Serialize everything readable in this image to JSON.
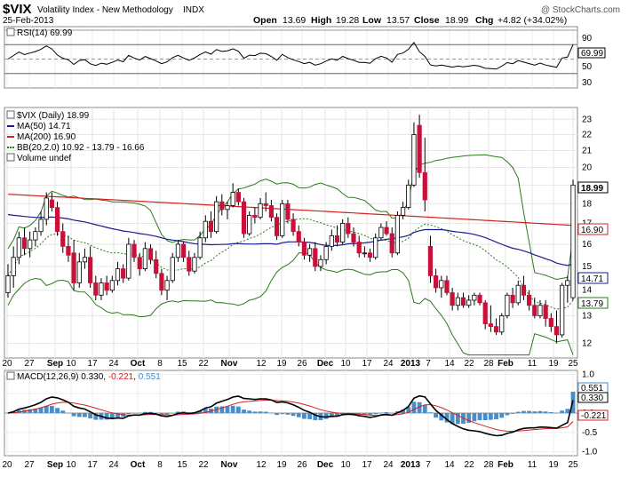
{
  "header": {
    "symbol": "$VIX",
    "name": "Volatility Index - New Methodology",
    "exchange": "INDX",
    "date": "25-Feb-2013",
    "watermark": "@ StockCharts.com",
    "open_label": "Open",
    "open": "13.69",
    "high_label": "High",
    "high": "19.28",
    "low_label": "Low",
    "low": "13.57",
    "close_label": "Close",
    "close": "18.99",
    "chg_label": "Chg",
    "chg": "+4.82 (+34.02%)"
  },
  "rsi": {
    "legend": "RSI(14) 69.99",
    "value_badge": "69.99",
    "ticks": [
      "90",
      "50",
      "30"
    ]
  },
  "price": {
    "legend": {
      "main": "$VIX (Daily) 18.99",
      "ma50": "MA(50) 14.71",
      "ma200": "MA(200) 16.90",
      "bb": "BB(20,2.0) 10.92 - 13.79 - 16.66",
      "volume": "Volume undef"
    },
    "badges": {
      "close": "18.99",
      "ma200": "16.90",
      "ma50": "14.71",
      "bb_mid": "13.79"
    },
    "yticks": [
      "23",
      "22",
      "21",
      "20",
      "19",
      "18",
      "17",
      "16",
      "15",
      "14",
      "13",
      "12"
    ],
    "colors": {
      "up": "#000000",
      "down": "#c8103a",
      "ma50": "#1a1a8c",
      "ma200": "#d42020",
      "bb": "#2a7a1a",
      "bbmid": "#2a7a1a"
    }
  },
  "xaxis": {
    "labels": [
      "20",
      "27",
      "Sep",
      "10",
      "17",
      "24",
      "Oct",
      "8",
      "15",
      "22",
      "Nov",
      "12",
      "19",
      "26",
      "Dec",
      "10",
      "17",
      "24",
      "2013",
      "7",
      "14",
      "22",
      "28",
      "Feb",
      "11",
      "19",
      "25"
    ]
  },
  "macd": {
    "legend_prefix": "MACD(12,26,9)",
    "legend_v1": "0.330",
    "legend_v2": "-0.221",
    "legend_v3": "0.551",
    "badges": {
      "hist": "0.551",
      "macd": "0.330",
      "signal": "-0.221"
    },
    "ticks": [
      "1.0",
      "0.5",
      "0.0",
      "-0.5",
      "-1.0"
    ],
    "colors": {
      "macd": "#000000",
      "signal": "#d42020",
      "hist": "#4a8ec8"
    }
  },
  "chart_data": {
    "type": "candlestick",
    "title": "$VIX Volatility Index - New Methodology INDX",
    "date": "25-Feb-2013",
    "y_range": [
      11.5,
      23.8
    ],
    "candles": [
      {
        "o": 13.9,
        "h": 15.1,
        "l": 13.7,
        "c": 14.6
      },
      {
        "o": 14.6,
        "h": 15.9,
        "l": 14.1,
        "c": 15.4
      },
      {
        "o": 15.4,
        "h": 16.6,
        "l": 15.1,
        "c": 16.3
      },
      {
        "o": 16.3,
        "h": 16.8,
        "l": 15.5,
        "c": 15.8
      },
      {
        "o": 15.8,
        "h": 16.6,
        "l": 15.4,
        "c": 16.2
      },
      {
        "o": 16.2,
        "h": 16.8,
        "l": 15.9,
        "c": 16.6
      },
      {
        "o": 16.6,
        "h": 17.6,
        "l": 16.4,
        "c": 17.2
      },
      {
        "o": 17.2,
        "h": 18.6,
        "l": 16.9,
        "c": 18.3
      },
      {
        "o": 18.2,
        "h": 18.6,
        "l": 17.6,
        "c": 17.8
      },
      {
        "o": 17.8,
        "h": 18.1,
        "l": 16.4,
        "c": 16.6
      },
      {
        "o": 16.6,
        "h": 17.0,
        "l": 15.6,
        "c": 15.9
      },
      {
        "o": 15.9,
        "h": 16.4,
        "l": 15.2,
        "c": 15.5
      },
      {
        "o": 15.6,
        "h": 16.2,
        "l": 14.0,
        "c": 14.3
      },
      {
        "o": 14.3,
        "h": 15.6,
        "l": 14.1,
        "c": 15.2
      },
      {
        "o": 15.2,
        "h": 15.8,
        "l": 14.9,
        "c": 15.4
      },
      {
        "o": 15.4,
        "h": 15.9,
        "l": 14.1,
        "c": 14.3
      },
      {
        "o": 14.3,
        "h": 14.6,
        "l": 13.6,
        "c": 13.8
      },
      {
        "o": 13.8,
        "h": 14.5,
        "l": 13.6,
        "c": 14.3
      },
      {
        "o": 14.3,
        "h": 14.6,
        "l": 13.8,
        "c": 14.0
      },
      {
        "o": 14.0,
        "h": 14.6,
        "l": 13.9,
        "c": 14.4
      },
      {
        "o": 14.4,
        "h": 15.2,
        "l": 14.2,
        "c": 14.9
      },
      {
        "o": 14.9,
        "h": 15.1,
        "l": 14.3,
        "c": 14.5
      },
      {
        "o": 14.5,
        "h": 16.3,
        "l": 14.4,
        "c": 16.0
      },
      {
        "o": 16.0,
        "h": 16.2,
        "l": 15.2,
        "c": 15.4
      },
      {
        "o": 15.4,
        "h": 15.6,
        "l": 14.6,
        "c": 14.9
      },
      {
        "o": 14.9,
        "h": 16.1,
        "l": 14.8,
        "c": 15.8
      },
      {
        "o": 15.8,
        "h": 16.0,
        "l": 15.1,
        "c": 15.3
      },
      {
        "o": 15.3,
        "h": 15.7,
        "l": 14.5,
        "c": 14.7
      },
      {
        "o": 14.7,
        "h": 14.9,
        "l": 13.8,
        "c": 14.0
      },
      {
        "o": 14.0,
        "h": 14.6,
        "l": 13.6,
        "c": 14.4
      },
      {
        "o": 14.4,
        "h": 15.6,
        "l": 14.3,
        "c": 15.4
      },
      {
        "o": 15.4,
        "h": 16.2,
        "l": 15.2,
        "c": 16.0
      },
      {
        "o": 16.0,
        "h": 16.1,
        "l": 15.2,
        "c": 15.4
      },
      {
        "o": 15.4,
        "h": 15.7,
        "l": 14.6,
        "c": 14.8
      },
      {
        "o": 14.8,
        "h": 15.6,
        "l": 14.7,
        "c": 15.4
      },
      {
        "o": 15.4,
        "h": 16.6,
        "l": 15.3,
        "c": 16.3
      },
      {
        "o": 16.3,
        "h": 17.4,
        "l": 16.1,
        "c": 17.1
      },
      {
        "o": 17.1,
        "h": 17.6,
        "l": 16.3,
        "c": 16.6
      },
      {
        "o": 16.6,
        "h": 18.4,
        "l": 16.5,
        "c": 18.1
      },
      {
        "o": 18.1,
        "h": 18.5,
        "l": 17.4,
        "c": 17.7
      },
      {
        "o": 17.7,
        "h": 18.1,
        "l": 17.2,
        "c": 17.9
      },
      {
        "o": 17.9,
        "h": 19.1,
        "l": 17.8,
        "c": 18.6
      },
      {
        "o": 18.6,
        "h": 18.8,
        "l": 17.9,
        "c": 18.1
      },
      {
        "o": 18.1,
        "h": 18.3,
        "l": 16.3,
        "c": 16.5
      },
      {
        "o": 16.5,
        "h": 17.6,
        "l": 16.4,
        "c": 17.4
      },
      {
        "o": 17.4,
        "h": 17.8,
        "l": 17.0,
        "c": 17.3
      },
      {
        "o": 17.3,
        "h": 18.3,
        "l": 17.2,
        "c": 18.0
      },
      {
        "o": 18.0,
        "h": 18.6,
        "l": 17.6,
        "c": 17.9
      },
      {
        "o": 17.9,
        "h": 18.2,
        "l": 17.1,
        "c": 17.3
      },
      {
        "o": 17.3,
        "h": 17.5,
        "l": 16.2,
        "c": 16.4
      },
      {
        "o": 16.4,
        "h": 18.2,
        "l": 16.3,
        "c": 18.0
      },
      {
        "o": 18.0,
        "h": 18.2,
        "l": 17.0,
        "c": 17.2
      },
      {
        "o": 17.2,
        "h": 17.5,
        "l": 16.4,
        "c": 16.6
      },
      {
        "o": 16.6,
        "h": 16.9,
        "l": 15.9,
        "c": 16.1
      },
      {
        "o": 16.1,
        "h": 16.3,
        "l": 15.3,
        "c": 15.5
      },
      {
        "o": 15.5,
        "h": 16.0,
        "l": 15.2,
        "c": 15.8
      },
      {
        "o": 15.8,
        "h": 16.1,
        "l": 14.8,
        "c": 15.0
      },
      {
        "o": 15.0,
        "h": 15.5,
        "l": 14.8,
        "c": 15.3
      },
      {
        "o": 15.3,
        "h": 16.1,
        "l": 15.1,
        "c": 15.9
      },
      {
        "o": 15.9,
        "h": 16.7,
        "l": 15.7,
        "c": 16.4
      },
      {
        "o": 16.4,
        "h": 16.9,
        "l": 15.9,
        "c": 16.1
      },
      {
        "o": 16.1,
        "h": 17.2,
        "l": 16.0,
        "c": 17.0
      },
      {
        "o": 17.0,
        "h": 17.3,
        "l": 16.3,
        "c": 16.5
      },
      {
        "o": 16.5,
        "h": 16.8,
        "l": 15.9,
        "c": 16.1
      },
      {
        "o": 16.1,
        "h": 16.4,
        "l": 15.4,
        "c": 15.6
      },
      {
        "o": 15.6,
        "h": 15.9,
        "l": 15.4,
        "c": 15.6
      },
      {
        "o": 15.6,
        "h": 15.8,
        "l": 15.2,
        "c": 15.4
      },
      {
        "o": 15.4,
        "h": 16.5,
        "l": 15.3,
        "c": 16.3
      },
      {
        "o": 16.3,
        "h": 17.0,
        "l": 16.2,
        "c": 16.8
      },
      {
        "o": 16.8,
        "h": 17.1,
        "l": 16.4,
        "c": 16.5
      },
      {
        "o": 16.5,
        "h": 16.8,
        "l": 15.4,
        "c": 15.6
      },
      {
        "o": 15.6,
        "h": 17.6,
        "l": 15.5,
        "c": 17.4
      },
      {
        "o": 17.4,
        "h": 18.1,
        "l": 17.2,
        "c": 17.8
      },
      {
        "o": 17.8,
        "h": 19.3,
        "l": 17.7,
        "c": 19.0
      },
      {
        "o": 19.0,
        "h": 22.8,
        "l": 18.9,
        "c": 22.0
      },
      {
        "o": 22.6,
        "h": 23.3,
        "l": 19.4,
        "c": 19.7
      },
      {
        "o": 19.7,
        "h": 21.8,
        "l": 17.6,
        "c": 18.2
      },
      {
        "o": 15.9,
        "h": 16.4,
        "l": 14.3,
        "c": 14.6
      },
      {
        "o": 14.6,
        "h": 14.9,
        "l": 13.9,
        "c": 14.1
      },
      {
        "o": 14.1,
        "h": 14.6,
        "l": 13.7,
        "c": 14.4
      },
      {
        "o": 14.4,
        "h": 14.6,
        "l": 13.8,
        "c": 13.9
      },
      {
        "o": 13.9,
        "h": 14.1,
        "l": 13.2,
        "c": 13.4
      },
      {
        "o": 13.4,
        "h": 13.9,
        "l": 13.2,
        "c": 13.7
      },
      {
        "o": 13.7,
        "h": 13.9,
        "l": 13.3,
        "c": 13.4
      },
      {
        "o": 13.4,
        "h": 13.8,
        "l": 13.3,
        "c": 13.6
      },
      {
        "o": 13.6,
        "h": 13.9,
        "l": 13.4,
        "c": 13.8
      },
      {
        "o": 13.8,
        "h": 13.9,
        "l": 13.4,
        "c": 13.5
      },
      {
        "o": 13.5,
        "h": 13.6,
        "l": 12.5,
        "c": 12.7
      },
      {
        "o": 12.7,
        "h": 13.4,
        "l": 12.4,
        "c": 12.6
      },
      {
        "o": 12.6,
        "h": 12.9,
        "l": 12.3,
        "c": 12.4
      },
      {
        "o": 12.4,
        "h": 13.1,
        "l": 12.3,
        "c": 13.0
      },
      {
        "o": 13.0,
        "h": 13.9,
        "l": 12.9,
        "c": 13.8
      },
      {
        "o": 13.8,
        "h": 14.1,
        "l": 13.3,
        "c": 13.5
      },
      {
        "o": 13.5,
        "h": 14.4,
        "l": 13.4,
        "c": 14.2
      },
      {
        "o": 14.2,
        "h": 14.6,
        "l": 13.6,
        "c": 13.8
      },
      {
        "o": 13.8,
        "h": 14.0,
        "l": 13.2,
        "c": 13.4
      },
      {
        "o": 13.4,
        "h": 13.7,
        "l": 12.9,
        "c": 13.0
      },
      {
        "o": 13.0,
        "h": 13.6,
        "l": 12.9,
        "c": 13.4
      },
      {
        "o": 13.4,
        "h": 13.6,
        "l": 12.6,
        "c": 12.9
      },
      {
        "o": 12.9,
        "h": 13.1,
        "l": 12.4,
        "c": 12.6
      },
      {
        "o": 12.6,
        "h": 13.2,
        "l": 12.0,
        "c": 12.3
      },
      {
        "o": 12.3,
        "h": 14.3,
        "l": 12.2,
        "c": 14.2
      },
      {
        "o": 14.2,
        "h": 14.6,
        "l": 13.5,
        "c": 14.4
      },
      {
        "o": 13.7,
        "h": 19.3,
        "l": 13.6,
        "c": 19.0
      }
    ],
    "series": [
      {
        "name": "MA(50)",
        "last": 14.71
      },
      {
        "name": "MA(200)",
        "last": 16.9
      },
      {
        "name": "BB(20,2.0)",
        "lower": 10.92,
        "middle": 13.79,
        "upper": 16.66
      }
    ],
    "rsi": {
      "name": "RSI(14)",
      "last": 69.99,
      "levels": [
        90,
        70,
        50,
        30,
        10
      ]
    },
    "macd_last": {
      "macd": 0.33,
      "signal": -0.221,
      "hist": 0.551
    },
    "ylim_macd": [
      -1.1,
      1.1
    ]
  }
}
